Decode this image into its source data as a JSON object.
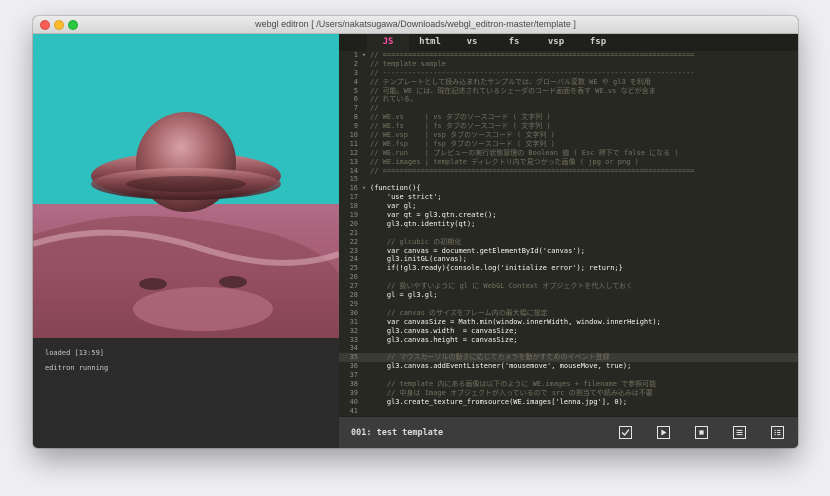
{
  "window": {
    "title": "webgl editron [ /Users/nakatsugawa/Downloads/webgl_editron-master/template ]"
  },
  "console": {
    "lines": [
      "loaded [13:59]",
      "editron running"
    ]
  },
  "tabs": [
    {
      "label": "JS",
      "active": true
    },
    {
      "label": "html",
      "active": false
    },
    {
      "label": "vs",
      "active": false
    },
    {
      "label": "fs",
      "active": false
    },
    {
      "label": "vsp",
      "active": false
    },
    {
      "label": "fsp",
      "active": false
    }
  ],
  "editor": {
    "highlighted_line": 35,
    "lines": [
      {
        "n": "1",
        "text": "// =========================================================================="
      },
      {
        "n": "2",
        "text": "// template sample"
      },
      {
        "n": "3",
        "text": "// --------------------------------------------------------------------------"
      },
      {
        "n": "4",
        "text": "// テンプレートとして読み込まれたサンプルでは、グローバル変数 WE や gl3 を利用"
      },
      {
        "n": "5",
        "text": "// 可能。WE には、現在記述されているシェーダのコード画面を表す WE.vs などが含ま"
      },
      {
        "n": "6",
        "text": "// れている。"
      },
      {
        "n": "7",
        "text": "//"
      },
      {
        "n": "8",
        "text": "// WE.vs     | vs タブのソースコード ( 文字列 )"
      },
      {
        "n": "9",
        "text": "// WE.fs     | fs タブのソースコード ( 文字列 )"
      },
      {
        "n": "10",
        "text": "// WE.vsp    | vsp タブのソースコード ( 文字列 )"
      },
      {
        "n": "11",
        "text": "// WE.fsp    | fsp タブのソースコード ( 文字列 )"
      },
      {
        "n": "12",
        "text": "// WE.run    | プレビューの実行状態管理の Boolean 値 ( Esc 押下で false になる )"
      },
      {
        "n": "13",
        "text": "// WE.images | template ディレクトリ内で見つかった画像 ( jpg or png )"
      },
      {
        "n": "14",
        "text": "// =========================================================================="
      },
      {
        "n": "15",
        "text": ""
      },
      {
        "n": "16",
        "text": "(function(){"
      },
      {
        "n": "17",
        "text": "    'use strict';"
      },
      {
        "n": "18",
        "text": "    var gl;"
      },
      {
        "n": "19",
        "text": "    var qt = gl3.qtn.create();"
      },
      {
        "n": "20",
        "text": "    gl3.qtn.identity(qt);"
      },
      {
        "n": "21",
        "text": ""
      },
      {
        "n": "22",
        "text": "    // glcubic の初期化"
      },
      {
        "n": "23",
        "text": "    var canvas = document.getElementById('canvas');"
      },
      {
        "n": "24",
        "text": "    gl3.initGL(canvas);"
      },
      {
        "n": "25",
        "text": "    if(!gl3.ready){console.log('initialize error'); return;}"
      },
      {
        "n": "26",
        "text": ""
      },
      {
        "n": "27",
        "text": "    // 扱いやすいように gl に WebGL Context オブジェクトを代入しておく"
      },
      {
        "n": "28",
        "text": "    gl = gl3.gl;"
      },
      {
        "n": "29",
        "text": ""
      },
      {
        "n": "30",
        "text": "    // canvas のサイズをフレーム内の最大幅に設定"
      },
      {
        "n": "31",
        "text": "    var canvasSize = Math.min(window.innerWidth, window.innerHeight);"
      },
      {
        "n": "32",
        "text": "    gl3.canvas.width  = canvasSize;"
      },
      {
        "n": "33",
        "text": "    gl3.canvas.height = canvasSize;"
      },
      {
        "n": "34",
        "text": ""
      },
      {
        "n": "35",
        "text": "    // マウスカーソルの動きに応じてカメラを動かすためのイベント登録"
      },
      {
        "n": "36",
        "text": "    gl3.canvas.addEventListener('mousemove', mouseMove, true);"
      },
      {
        "n": "37",
        "text": ""
      },
      {
        "n": "38",
        "text": "    // template 内にある画像は以下のように WE.images + filename で参照可能"
      },
      {
        "n": "39",
        "text": "    // 中身は Image オブジェクトが入っているので src の割当てや読み込みは不要"
      },
      {
        "n": "40",
        "text": "    gl3.create_texture_fromsource(WE.images['lenna.jpg'], 0);"
      },
      {
        "n": "41",
        "text": ""
      }
    ]
  },
  "status": {
    "text": "001: test template",
    "buttons": [
      {
        "name": "checkbox-button",
        "icon": "check-icon"
      },
      {
        "name": "play-button",
        "icon": "play-icon"
      },
      {
        "name": "stop-button",
        "icon": "stop-icon"
      },
      {
        "name": "list-button",
        "icon": "list-icon"
      },
      {
        "name": "grid-list-button",
        "icon": "grid-list-icon"
      }
    ]
  },
  "colors": {
    "canvas_bg": "#2ebfbf",
    "active_tab": "#ff4fa8",
    "editor_bg": "#272822",
    "comment": "#75715e"
  }
}
